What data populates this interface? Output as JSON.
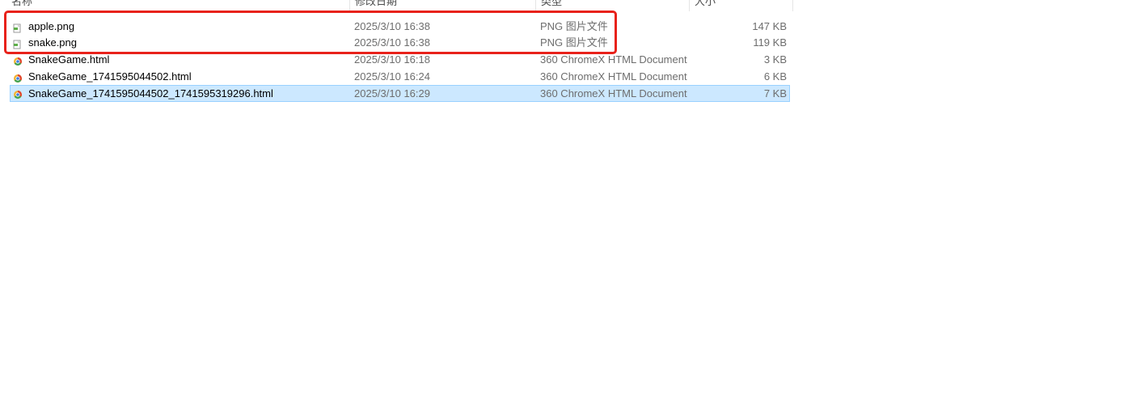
{
  "columns": {
    "name": "名称",
    "date_modified": "修改日期",
    "type": "类型",
    "size": "大小"
  },
  "files": [
    {
      "name": "apple.png",
      "date": "2025/3/10 16:38",
      "type": "PNG 图片文件",
      "size": "147 KB",
      "icon": "png-file-icon",
      "selected": false
    },
    {
      "name": "snake.png",
      "date": "2025/3/10 16:38",
      "type": "PNG 图片文件",
      "size": "119 KB",
      "icon": "png-file-icon",
      "selected": false
    },
    {
      "name": "SnakeGame.html",
      "date": "2025/3/10 16:18",
      "type": "360 ChromeX HTML Document",
      "size": "3 KB",
      "icon": "html-file-icon",
      "selected": false
    },
    {
      "name": "SnakeGame_1741595044502.html",
      "date": "2025/3/10 16:24",
      "type": "360 ChromeX HTML Document",
      "size": "6 KB",
      "icon": "html-file-icon",
      "selected": false
    },
    {
      "name": "SnakeGame_1741595044502_1741595319296.html",
      "date": "2025/3/10 16:29",
      "type": "360 ChromeX HTML Document",
      "size": "7 KB",
      "icon": "html-file-icon",
      "selected": true
    }
  ],
  "colors": {
    "selection_bg": "#cce8ff",
    "selection_border": "#99d1ff",
    "annotation_red": "#e8221b"
  }
}
